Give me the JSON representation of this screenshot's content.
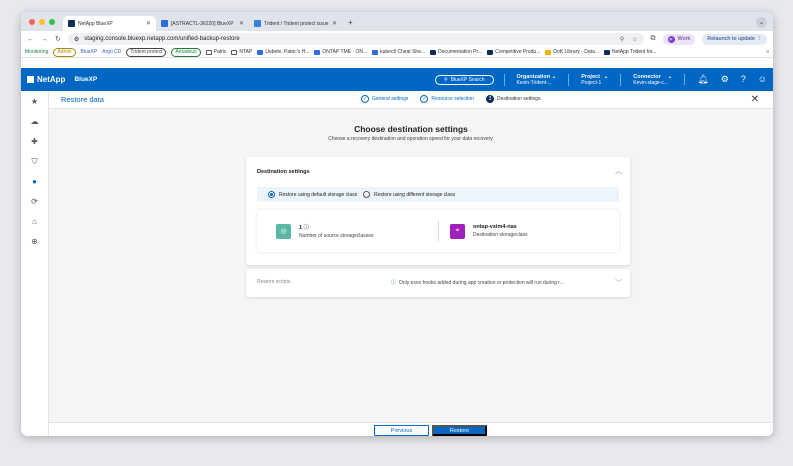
{
  "browser": {
    "tabs": [
      {
        "title": "NetApp BlueXP",
        "favicon_color": "#0d2d5a",
        "active": true
      },
      {
        "title": "[ASTRACTL-36220] BlueXP",
        "favicon_color": "#2b6cd8",
        "active": false
      },
      {
        "title": "Trident / Trident protect issue",
        "favicon_color": "#3b7de0",
        "active": false
      }
    ],
    "new_tab": "+",
    "url": "staging.console.bluexp.netapp.com/unified-backup-restore",
    "profile_initial": "P",
    "profile_label": "Work",
    "relaunch_label": "Relaunch to update"
  },
  "bookmarks": {
    "items": [
      {
        "label": "Monitoring",
        "kind": "text",
        "color": "#1a7f37"
      },
      {
        "label": "Admin",
        "kind": "chip",
        "color": "#a8870c"
      },
      {
        "label": "BlueXP",
        "kind": "text",
        "color": "#3b5bdb"
      },
      {
        "label": "Argo CD",
        "kind": "text",
        "color": "#3b5bdb"
      },
      {
        "label": "Trident protect",
        "kind": "chip",
        "color": "#444444"
      },
      {
        "label": "Amadeus",
        "kind": "chip",
        "color": "#1a7f37"
      },
      {
        "label": "Patric",
        "kind": "folder",
        "color": "#555555"
      },
      {
        "label": "NTAP",
        "kind": "folder",
        "color": "#555555"
      },
      {
        "label": "Uebele, Patric's H...",
        "kind": "icon",
        "color": "#2f6fde"
      },
      {
        "label": "ONTAP TME - ON...",
        "kind": "icon",
        "color": "#2f6fde"
      },
      {
        "label": "kubectl Cheat She...",
        "kind": "icon",
        "color": "#326ce5"
      },
      {
        "label": "Documentation Pr...",
        "kind": "icon",
        "color": "#0d2d5a"
      },
      {
        "label": "Competitive Produ...",
        "kind": "icon",
        "color": "#0d2d5a"
      },
      {
        "label": "DoK Library - Data...",
        "kind": "icon",
        "color": "#f2b600"
      },
      {
        "label": "NetApp Trident for...",
        "kind": "icon",
        "color": "#0d2d5a"
      }
    ],
    "more": "»"
  },
  "app_header": {
    "brand": "NetApp",
    "product": "BlueXP",
    "search_label": "BlueXP Search",
    "organization": {
      "label": "Organization",
      "value": "Kevin-Trident-..."
    },
    "project": {
      "label": "Project",
      "value": "Project-1"
    },
    "connector": {
      "label": "Connector",
      "value": "Kevin-stage-c..."
    }
  },
  "page": {
    "title": "Restore data",
    "steps": [
      {
        "label": "General settings",
        "state": "done",
        "marker": "✓"
      },
      {
        "label": "Resource selection",
        "state": "done",
        "marker": "✓"
      },
      {
        "label": "Destination settings",
        "state": "current",
        "marker": "3"
      }
    ],
    "heading": "Choose destination settings",
    "subheading": "Choose a recovery destination and operation speed for your data recovery."
  },
  "destination_settings": {
    "title": "Destination settings",
    "radio_default": "Restore using default storage class",
    "radio_different": "Restore using different storage class",
    "selected": "default",
    "source": {
      "value": "1",
      "label": "Number of source storageclasses",
      "color": "#57b9a1"
    },
    "destination": {
      "value": "ontap-vsim4-nas",
      "label": "Destination storageclass",
      "color": "#a11fbd"
    }
  },
  "restore_scripts": {
    "title": "Restore scripts",
    "message": "Only exec hooks added during app creation or protection will run during r..."
  },
  "footer": {
    "previous": "Previous",
    "restore": "Restore"
  },
  "colors": {
    "primary": "#0067c5",
    "header": "#0067c5"
  }
}
